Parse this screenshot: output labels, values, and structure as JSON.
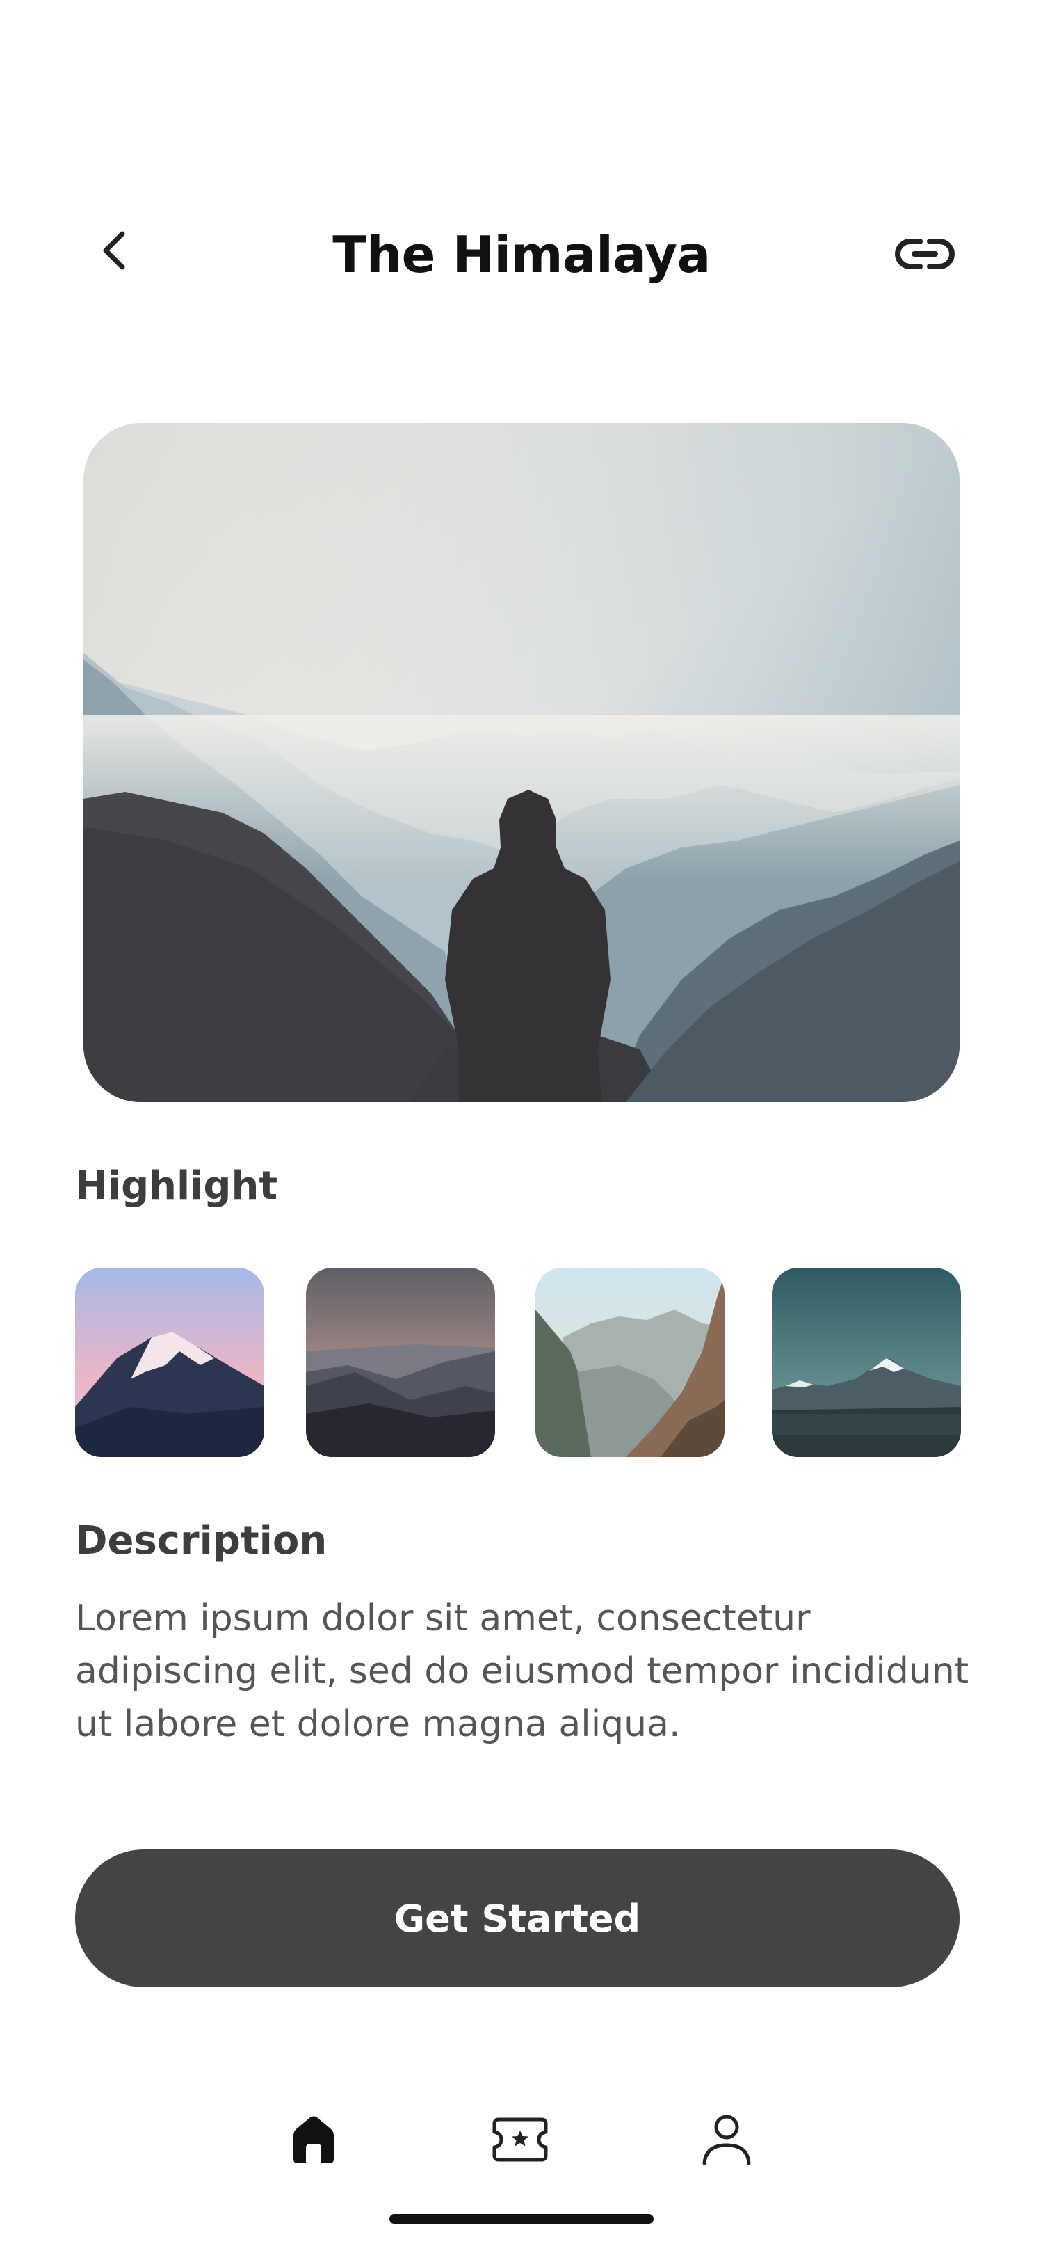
{
  "header": {
    "title": "The Himalaya",
    "back_icon": "chevron-left-icon",
    "link_icon": "link-icon"
  },
  "hero": {
    "image": "hooded person overlooking misty mountain ranges"
  },
  "highlight": {
    "heading": "Highlight",
    "thumbnails": [
      {
        "image": "snow-capped peak at pink dusk"
      },
      {
        "image": "layered mountain silhouettes at sunset"
      },
      {
        "image": "rocky cliffs above a valley"
      },
      {
        "image": "snowy peak under teal sky"
      }
    ]
  },
  "description": {
    "heading": "Description",
    "text": "Lorem ipsum dolor sit amet, consectetur adipiscing elit, sed do eiusmod tempor incididunt ut labore et dolore magna aliqua."
  },
  "cta": {
    "label": "Get Started"
  },
  "bottom_nav": {
    "items": [
      {
        "icon": "home-icon",
        "active": true
      },
      {
        "icon": "ticket-star-icon",
        "active": false
      },
      {
        "icon": "user-icon",
        "active": false
      }
    ]
  },
  "colors": {
    "button_bg": "#444444",
    "text_primary": "#111111",
    "text_secondary": "#555555"
  }
}
